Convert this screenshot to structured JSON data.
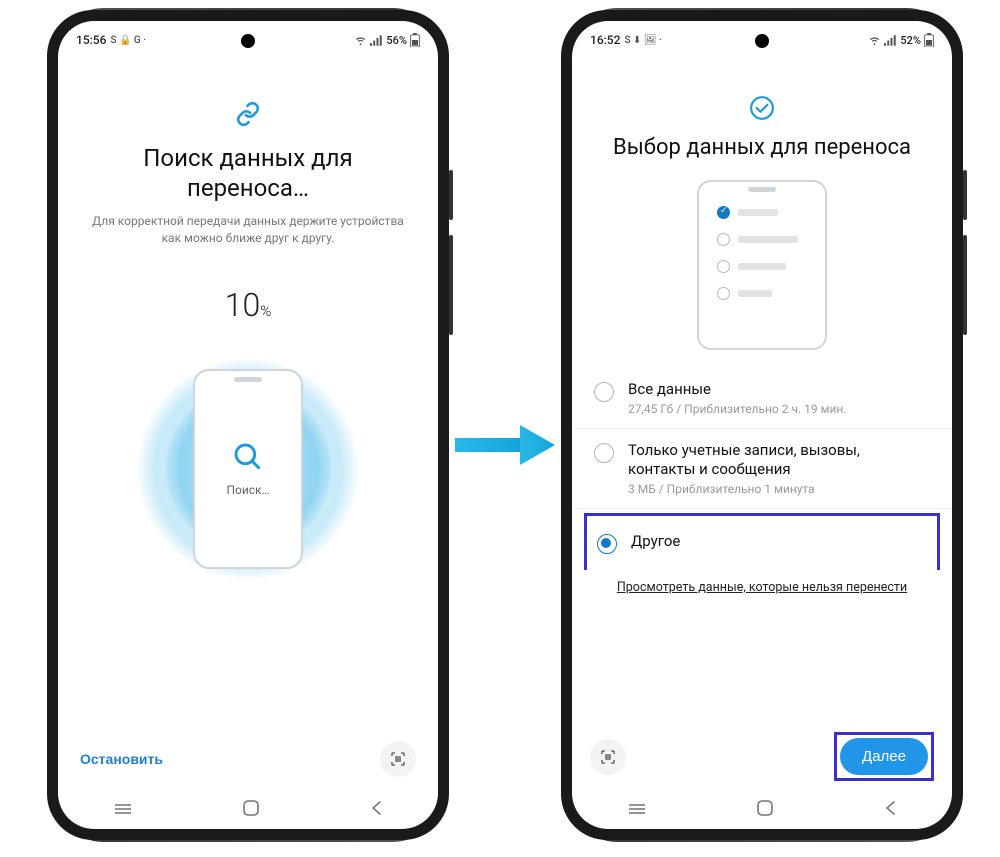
{
  "left": {
    "status": {
      "time": "15:56",
      "icons": "S 🔒 G ·",
      "battery": "56%"
    },
    "title": "Поиск данных для переноса…",
    "subtitle": "Для корректной передачи данных держите устройства как можно ближе друг к другу.",
    "progress_value": "10",
    "progress_unit": "%",
    "search_label": "Поиск…",
    "stop_label": "Остановить"
  },
  "right": {
    "status": {
      "time": "16:52",
      "icons": "S ⬇ 🖼 ·",
      "battery": "52%"
    },
    "title": "Выбор данных для переноса",
    "options": [
      {
        "title": "Все данные",
        "sub": "27,45 Гб / Приблизительно 2 ч. 19 мин."
      },
      {
        "title": "Только учетные записи, вызовы, контакты и сообщения",
        "sub": "3 МБ / Приблизительно 1 минута"
      },
      {
        "title": "Другое",
        "sub": ""
      }
    ],
    "view_unsupported": "Просмотреть данные, которые нельзя перенести",
    "next_label": "Далее"
  }
}
